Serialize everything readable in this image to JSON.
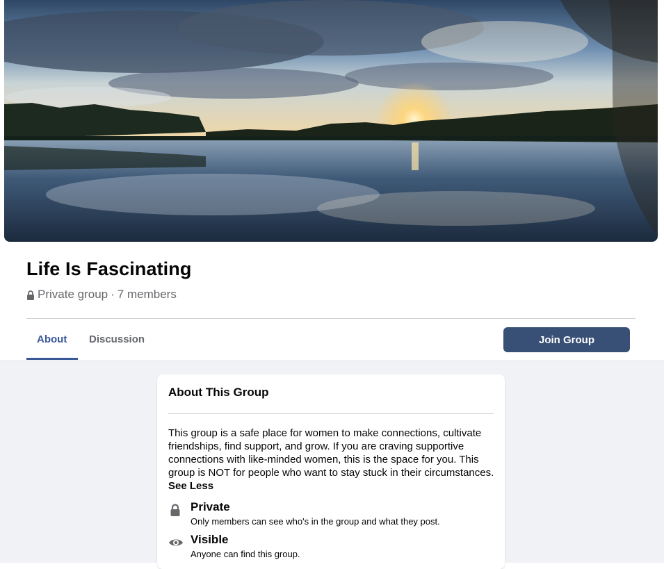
{
  "group": {
    "name": "Life Is Fascinating",
    "privacy": "Private group",
    "separator": "·",
    "members": "7 members"
  },
  "tabs": [
    {
      "label": "About",
      "active": true
    },
    {
      "label": "Discussion",
      "active": false
    }
  ],
  "join_button": "Join Group",
  "about": {
    "title": "About This Group",
    "description": "This group is a safe place for women to make connections, cultivate friendships, find support, and grow. If you are craving supportive connections with like-minded women, this is the space for you. This group is NOT for people who want to stay stuck in their circumstances.",
    "see_less": "See Less",
    "private": {
      "label": "Private",
      "detail": "Only members can see who's in the group and what they post.",
      "icon": "lock-icon"
    },
    "visible": {
      "label": "Visible",
      "detail": "Anyone can find this group.",
      "icon": "eye-icon"
    }
  },
  "colors": {
    "accent": "#385898",
    "button": "#385076",
    "background": "#f0f2f5",
    "muted_text": "#65676b"
  }
}
